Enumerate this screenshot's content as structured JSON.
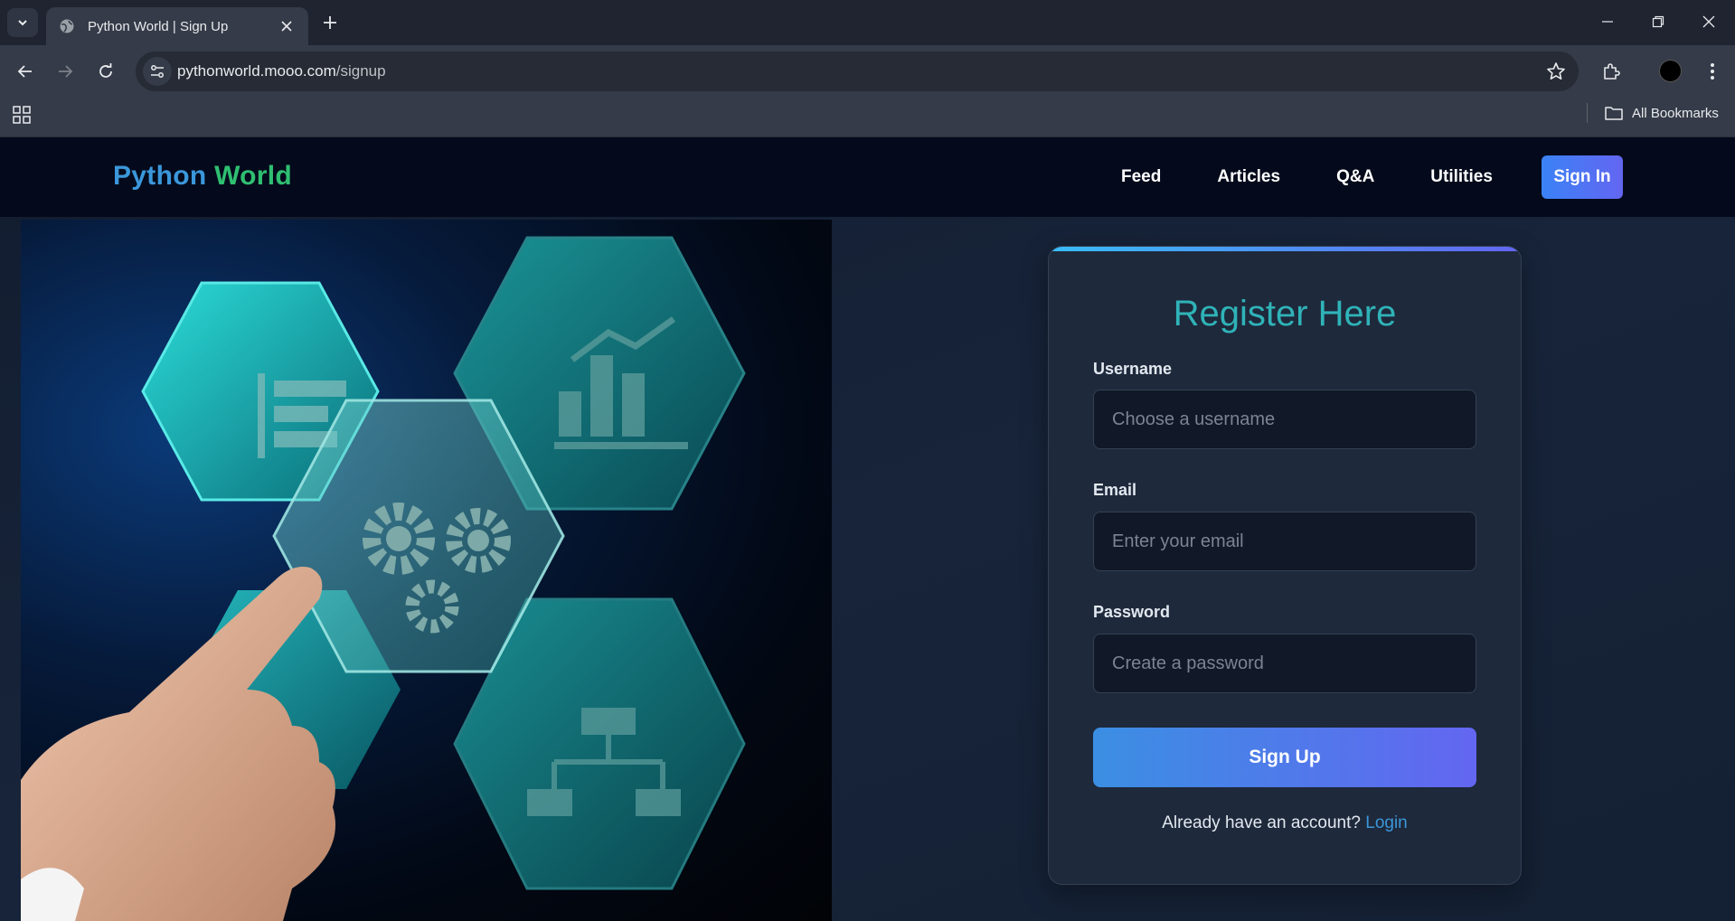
{
  "browser": {
    "tab_title": "Python World | Sign Up",
    "url_host": "pythonworld.mooo.com",
    "url_path": "/signup",
    "bookmarks_label": "All Bookmarks",
    "icons": [
      "tab-list-icon",
      "globe-icon",
      "close-icon",
      "plus-icon",
      "minimize-icon",
      "restore-icon",
      "window-close-icon",
      "back-icon",
      "forward-icon",
      "reload-icon",
      "site-info-icon",
      "star-icon",
      "extensions-icon",
      "menu-icon",
      "apps-icon",
      "folder-icon"
    ]
  },
  "site": {
    "brand_part1": "Python",
    "brand_part2": "World",
    "nav": [
      "Feed",
      "Articles",
      "Q&A",
      "Utilities"
    ],
    "signin_label": "Sign In",
    "colors": {
      "brand_blue": "#3b97db",
      "brand_green": "#2fbf71",
      "accent": "#6366f1",
      "title_teal": "#2fb3b8"
    }
  },
  "form": {
    "title": "Register Here",
    "username_label": "Username",
    "username_placeholder": "Choose a username",
    "email_label": "Email",
    "email_placeholder": "Enter your email",
    "password_label": "Password",
    "password_placeholder": "Create a password",
    "submit_label": "Sign Up",
    "footer_text": "Already have an account?",
    "footer_link": "Login"
  }
}
